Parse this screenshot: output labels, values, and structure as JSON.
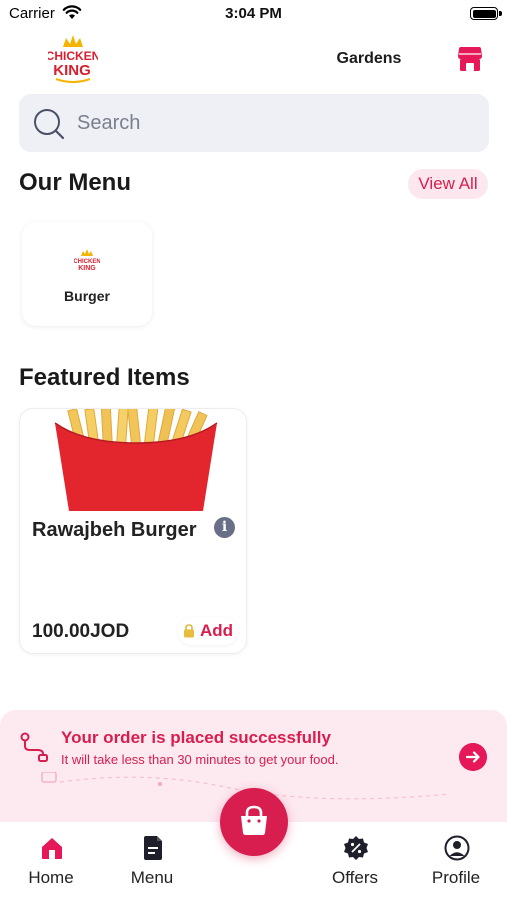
{
  "status_bar": {
    "carrier": "Carrier",
    "time": "3:04 PM"
  },
  "header": {
    "logo_text_line1": "CHICKEN",
    "logo_text_line2": "KING",
    "branch_name": "Gardens",
    "store_icon": "store-icon"
  },
  "search": {
    "placeholder": "Search"
  },
  "our_menu": {
    "title": "Our Menu",
    "view_all": "View All",
    "categories": [
      {
        "label": "Burger"
      }
    ]
  },
  "featured": {
    "title": "Featured Items",
    "items": [
      {
        "name": "Rawajbeh Burger",
        "price": "100.00JOD",
        "add_label": "Add"
      }
    ]
  },
  "order_banner": {
    "title": "Your order is placed successfully",
    "subtitle": "It will take less than  30  minutes to get your food."
  },
  "bottom_nav": {
    "items": [
      {
        "label": "Home",
        "icon": "home-icon",
        "active": true
      },
      {
        "label": "Menu",
        "icon": "menu-icon",
        "active": false
      },
      {
        "label": "Offers",
        "icon": "offers-icon",
        "active": false
      },
      {
        "label": "Profile",
        "icon": "profile-icon",
        "active": false
      }
    ],
    "cart_icon": "shopping-bag-icon"
  },
  "colors": {
    "accent": "#d81e4f",
    "search_bg": "#eef0f5",
    "banner_bg": "#fde9f0"
  }
}
